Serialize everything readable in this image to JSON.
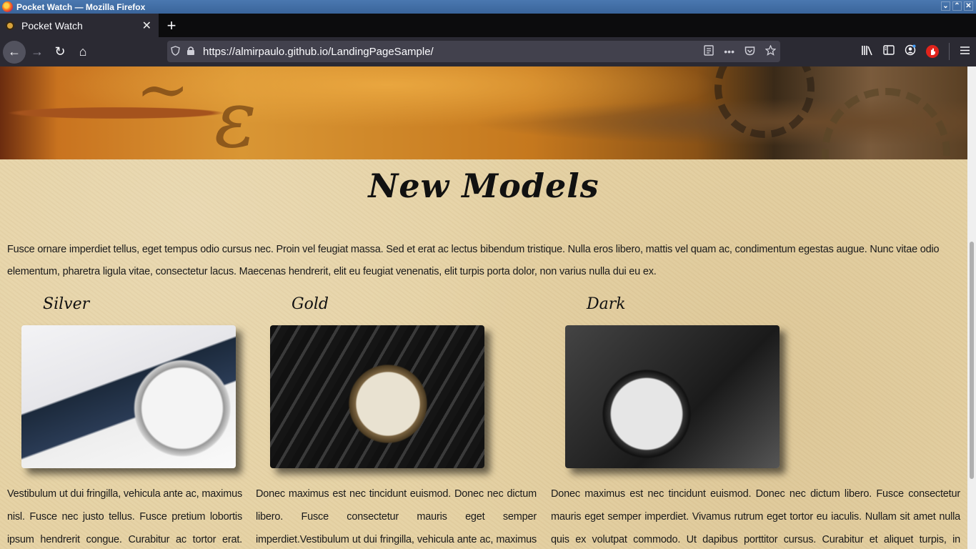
{
  "window": {
    "title": "Pocket Watch — Mozilla Firefox",
    "controls": [
      "⌄",
      "⌃",
      "✕"
    ]
  },
  "tabs": [
    {
      "label": "Pocket Watch",
      "close": "✕"
    }
  ],
  "new_tab": "+",
  "nav": {
    "back": "←",
    "forward": "→",
    "reload": "↻",
    "home": "⌂",
    "url": "https://almirpaulo.github.io/LandingPageSample/",
    "page_actions": "•••"
  },
  "page": {
    "section_title": "New Models",
    "intro": "Fusce ornare imperdiet tellus, eget tempus odio cursus nec. Proin vel feugiat massa. Sed et erat ac lectus bibendum tristique. Nulla eros libero, mattis vel quam ac, condimentum egestas augue. Nunc vitae odio elementum, pharetra ligula vitae, consectetur lacus. Maecenas hendrerit, elit eu feugiat venenatis, elit turpis porta dolor, non varius nulla dui eu ex.",
    "models": [
      {
        "name": "Silver",
        "text": "Vestibulum ut dui fringilla, vehicula ante ac, maximus nisl. Fusce nec justo tellus. Fusce pretium lobortis ipsum hendrerit congue. Curabitur ac tortor erat. Donec maximus"
      },
      {
        "name": "Gold",
        "text": "Donec maximus est nec tincidunt euismod. Donec nec dictum libero. Fusce consectetur mauris eget semper imperdiet.Vestibulum ut dui fringilla, vehicula ante ac, maximus nisl. Fusce nec justo tellus. Fusce"
      },
      {
        "name": "Dark",
        "text": "Donec maximus est nec tincidunt euismod. Donec nec dictum libero. Fusce consectetur mauris eget semper imperdiet. Vivamus rutrum eget tortor eu iaculis. Nullam sit amet nulla quis ex volutpat commodo. Ut dapibus porttitor cursus. Curabitur et aliquet turpis, in vulputate diam. Praesent aliquet tellus feugiat"
      }
    ]
  }
}
